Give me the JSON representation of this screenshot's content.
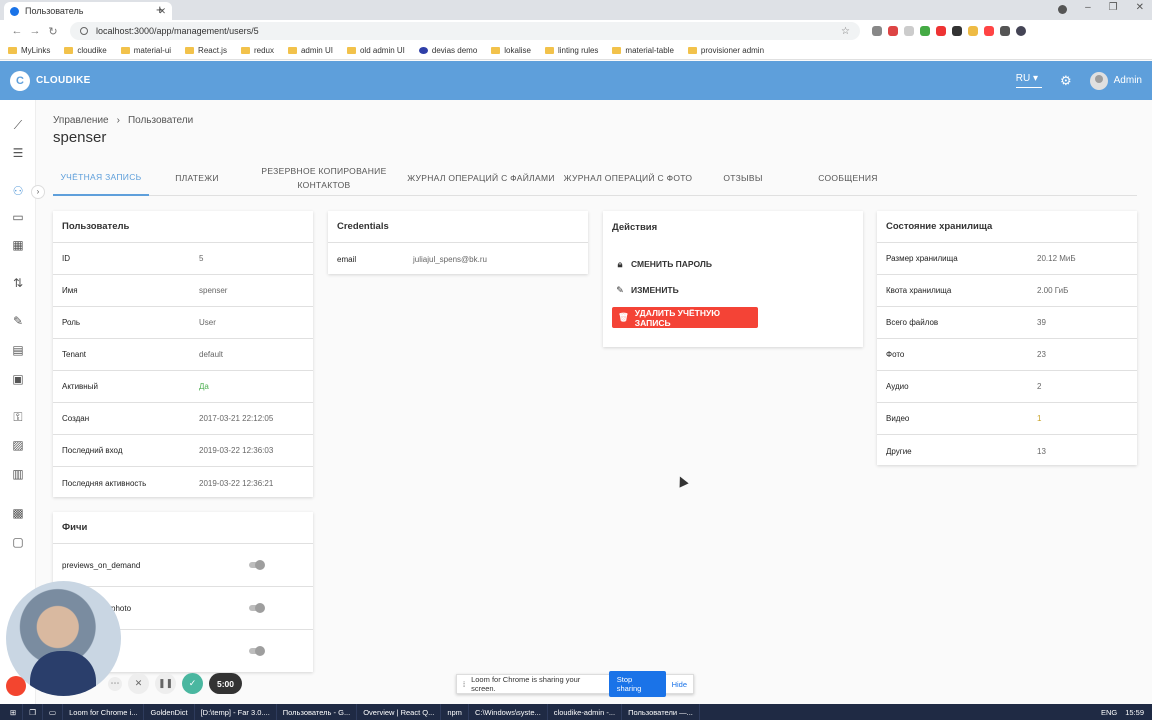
{
  "browser": {
    "tab_title": "Пользователь",
    "url": "localhost:3000/app/management/users/5",
    "bookmarks": [
      "MyLinks",
      "cloudike",
      "material-ui",
      "React.js",
      "redux",
      "admin UI",
      "old admin UI",
      "devias demo",
      "lokalise",
      "linting rules",
      "material-table",
      "provisioner admin"
    ]
  },
  "header": {
    "brand": "CLOUDIKE",
    "lang": "RU",
    "user": "Admin",
    "color": "#5e9fdb"
  },
  "breadcrumb": {
    "parent": "Управление",
    "separator": "›",
    "current": "Пользователи"
  },
  "page_title": "spenser",
  "tabs": [
    "Учётная запись",
    "Платежи",
    "Резервное копирование контактов",
    "Журнал операций с файлами",
    "Журнал операций с фото",
    "Отзывы",
    "Сообщения"
  ],
  "user_card": {
    "title": "Пользователь",
    "rows": [
      {
        "k": "ID",
        "v": "5"
      },
      {
        "k": "Имя",
        "v": "spenser"
      },
      {
        "k": "Роль",
        "v": "User"
      },
      {
        "k": "Tenant",
        "v": "default"
      },
      {
        "k": "Активный",
        "v": "Да"
      },
      {
        "k": "Создан",
        "v": "2017-03-21  22:12:05"
      },
      {
        "k": "Последний вход",
        "v": "2019-03-22  12:36:03"
      },
      {
        "k": "Последняя активность",
        "v": "2019-03-22  12:36:21"
      }
    ]
  },
  "credentials_card": {
    "title": "Credentials",
    "rows": [
      {
        "k": "email",
        "v": "juliajul_spens@bk.ru"
      }
    ]
  },
  "actions_card": {
    "title": "Действия",
    "change_password": "Сменить пароль",
    "edit": "Изменить",
    "delete": "Удалить учётную запись"
  },
  "storage_card": {
    "title": "Состояние хранилища",
    "rows": [
      {
        "k": "Размер хранилища",
        "v": "20.12 МиБ"
      },
      {
        "k": "Квота хранилища",
        "v": "2.00 ГиБ"
      },
      {
        "k": "Всего файлов",
        "v": "39"
      },
      {
        "k": "Фото",
        "v": "23"
      },
      {
        "k": "Аудио",
        "v": "2"
      },
      {
        "k": "Видео",
        "v": "1"
      },
      {
        "k": "Другие",
        "v": "13"
      }
    ]
  },
  "features_card": {
    "title": "Фичи",
    "rows": [
      "previews_on_demand",
      "photo",
      ""
    ]
  },
  "loom": {
    "timer": "5:00",
    "share_text": "Loom for Chrome is sharing your screen.",
    "stop": "Stop sharing",
    "hide": "Hide"
  },
  "taskbar": {
    "items": [
      "Loom for Chrome i...",
      "GoldenDict",
      "[D:\\temp] - Far 3.0....",
      "Пользователь - G...",
      "Overview | React Q...",
      "npm",
      "C:\\Windows\\syste...",
      "cloudike-admin -...",
      "Пользователи —..."
    ],
    "lang": "ENG",
    "time": "15:59"
  }
}
